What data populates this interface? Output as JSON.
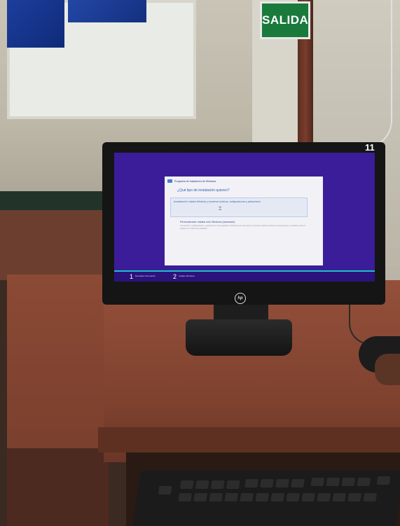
{
  "scene": {
    "wall_sign": "SALIDA",
    "monitor_badge": "11",
    "monitor_brand_logo": "hp"
  },
  "installer": {
    "title": "Programa de instalación de Windows",
    "question": "¿Qué tipo de instalación quieres?",
    "option_upgrade": "Actualización: instalar Windows y conservar archivos, configuraciones y aplicaciones",
    "option_custom_title": "Personalizada: instalar solo Windows (avanzado)",
    "option_custom_desc": "Los archivos, configuraciones y aplicaciones no se trasladan a Windows con esta opción. Si quieres realizar cambios en las particiones y unidades, inicia el equipo con el disco de instalación.",
    "steps": [
      {
        "number": "1",
        "label": "Recopilar información"
      },
      {
        "number": "2",
        "label": "Instalar Windows"
      }
    ]
  },
  "colors": {
    "screen_bg": "#3c1d99",
    "dialog_bg": "#f2f1f5",
    "progress_accent": "#1ec0c8",
    "sign_green": "#1a7a3c",
    "desk": "#94503a"
  }
}
